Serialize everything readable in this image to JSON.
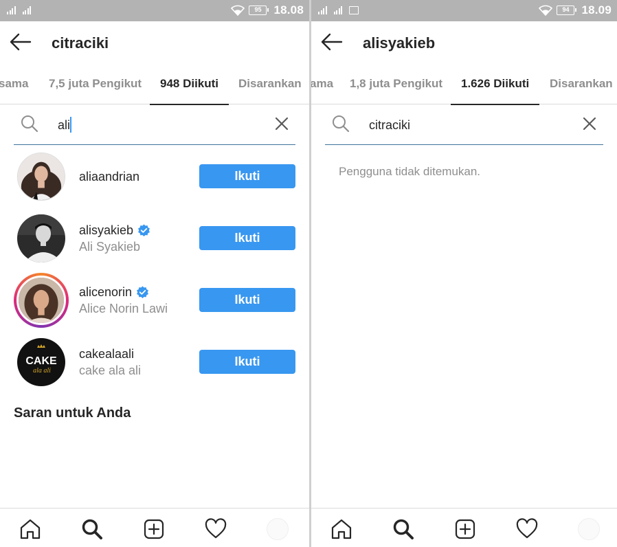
{
  "colors": {
    "accent": "#3897f0",
    "status_bar": "#b3b3b3",
    "secondary_text": "#8e8e8e",
    "primary_text": "#262626"
  },
  "left_screen": {
    "status": {
      "battery": "95",
      "time": "18.08"
    },
    "header": {
      "title": "citraciki"
    },
    "tabs": [
      {
        "label": "sama"
      },
      {
        "label": "7,5 juta Pengikut"
      },
      {
        "label": "948 Diikuti"
      },
      {
        "label": "Disarankan"
      }
    ],
    "search": {
      "value": "ali",
      "clear_icon": "close-icon"
    },
    "results": [
      {
        "username": "aliaandrian",
        "full_name": "",
        "verified": false,
        "button": "Ikuti"
      },
      {
        "username": "alisyakieb",
        "full_name": "Ali Syakieb",
        "verified": true,
        "button": "Ikuti"
      },
      {
        "username": "alicenorin",
        "full_name": "Alice Norin Lawi",
        "verified": true,
        "button": "Ikuti"
      },
      {
        "username": "cakealaali",
        "full_name": "cake ala ali",
        "verified": false,
        "button": "Ikuti"
      }
    ],
    "logo_text": {
      "top": "CAKE",
      "bottom": "ala ali"
    },
    "section_title": "Saran untuk Anda"
  },
  "right_screen": {
    "status": {
      "battery": "94",
      "time": "18.09"
    },
    "header": {
      "title": "alisyakieb"
    },
    "tabs": [
      {
        "label": "ama"
      },
      {
        "label": "1,8 juta Pengikut"
      },
      {
        "label": "1.626 Diikuti"
      },
      {
        "label": "Disarankan"
      }
    ],
    "search": {
      "value": "citraciki"
    },
    "empty_message": "Pengguna tidak ditemukan."
  },
  "bottom_nav": [
    "home-icon",
    "search-icon",
    "add-post-icon",
    "heart-icon",
    "profile-avatar"
  ]
}
